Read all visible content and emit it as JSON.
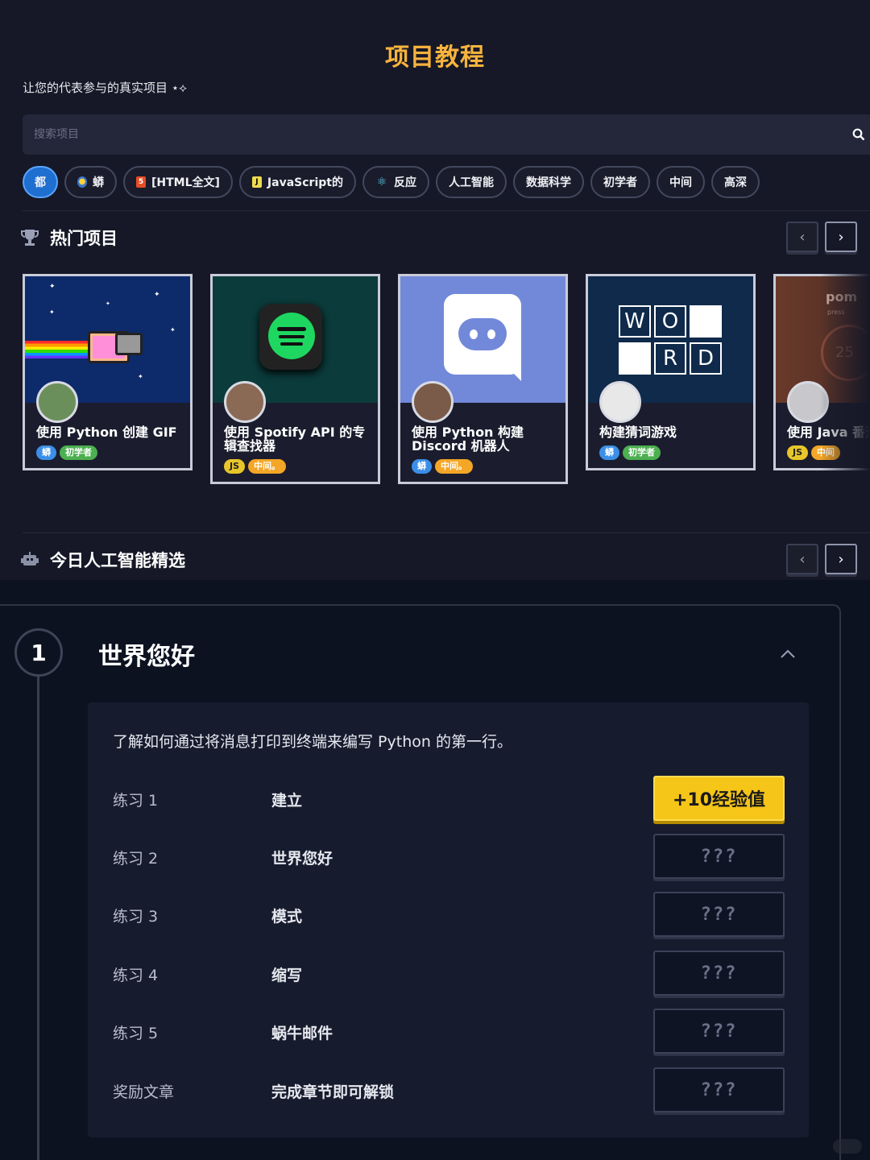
{
  "page": {
    "title": "项目教程",
    "subtitle": "让您的代表参与的真实项目 ⋆⟡"
  },
  "search": {
    "placeholder": "搜索项目"
  },
  "filters": [
    {
      "label": "都",
      "active": true
    },
    {
      "label": "蟒",
      "icon": "python-icon"
    },
    {
      "label": "[HTML全文]",
      "icon": "html5-icon"
    },
    {
      "label": "JavaScript的",
      "icon": "javascript-icon"
    },
    {
      "label": "反应",
      "icon": "react-icon"
    },
    {
      "label": "人工智能"
    },
    {
      "label": "数据科学"
    },
    {
      "label": "初学者"
    },
    {
      "label": "中间"
    },
    {
      "label": "高深"
    }
  ],
  "popular": {
    "heading": "热门项目",
    "cards": [
      {
        "title": "使用 Python 创建 GIF",
        "tags": [
          "蟒",
          "初学者"
        ]
      },
      {
        "title": "使用 Spotify API 的专辑查找器",
        "tags": [
          "JS",
          "中间。"
        ]
      },
      {
        "title": "使用 Python 构建 Discord 机器人",
        "tags": [
          "蟒",
          "中间。"
        ]
      },
      {
        "title": "构建猜词游戏",
        "tags": [
          "蟒",
          "初学者"
        ],
        "thumb_letters": [
          "W",
          "O",
          "R",
          "D"
        ]
      },
      {
        "title": "使用 Java 番茄工作",
        "tags": [
          "JS",
          "中间"
        ],
        "thumb_text": [
          "pom",
          "press",
          "25"
        ]
      }
    ]
  },
  "ai": {
    "heading": "今日人工智能精选"
  },
  "chapter": {
    "number": "1",
    "title": "世界您好",
    "description": "了解如何通过将消息打印到终端来编写 Python 的第一行。",
    "exercises": [
      {
        "label": "练习 1",
        "name": "建立",
        "xp": "+10经验值"
      },
      {
        "label": "练习 2",
        "name": "世界您好",
        "xp": "???"
      },
      {
        "label": "练习 3",
        "name": "模式",
        "xp": "???"
      },
      {
        "label": "练习 4",
        "name": "缩写",
        "xp": "???"
      },
      {
        "label": "练习 5",
        "name": "蜗牛邮件",
        "xp": "???"
      },
      {
        "label": "奖励文章",
        "name": "完成章节即可解锁",
        "xp": "???"
      }
    ]
  },
  "colors": {
    "accent": "#f7b33c",
    "active_chip": "#1f6fd1",
    "xp_gold": "#f5c518"
  }
}
